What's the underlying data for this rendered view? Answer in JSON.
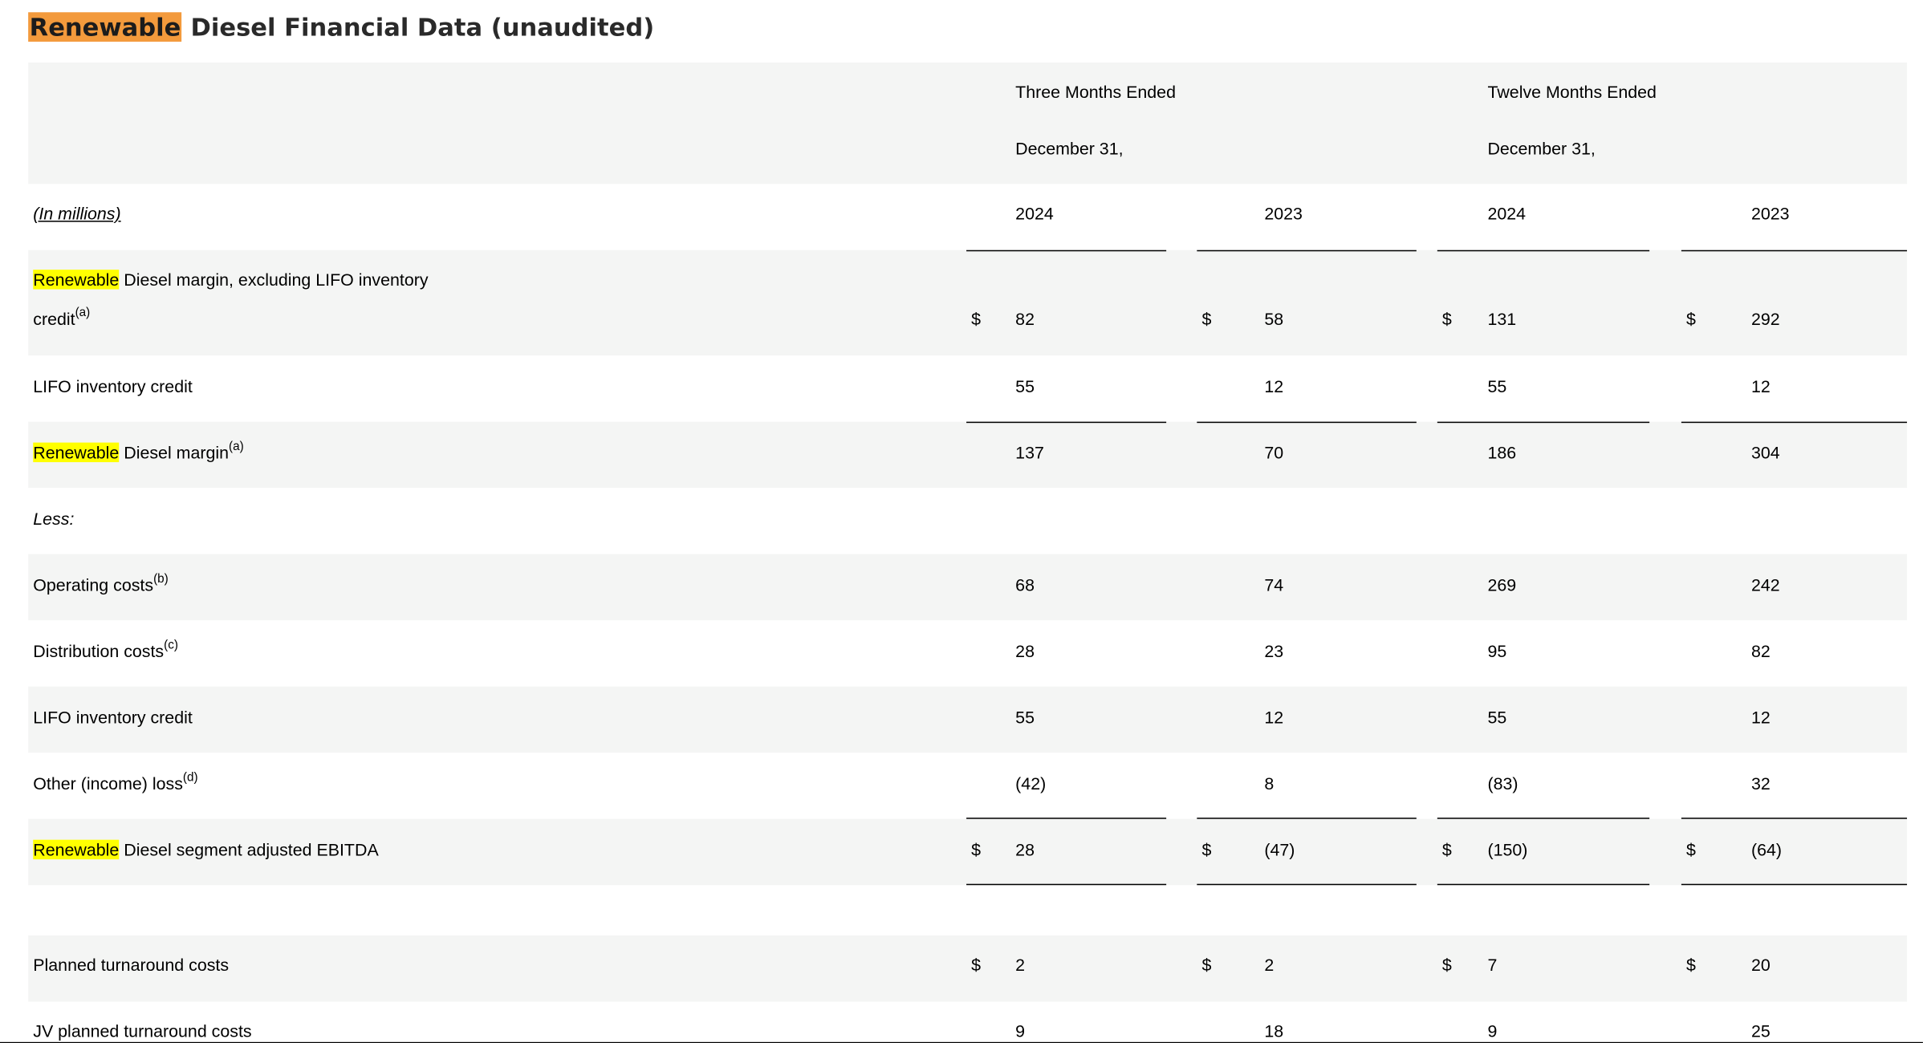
{
  "title": {
    "highlight": "Renewable",
    "rest": " Diesel Financial Data (unaudited)"
  },
  "header": {
    "three_months_line1": "Three Months Ended",
    "three_months_line2": "December 31,",
    "twelve_months_line1": "Twelve Months Ended",
    "twelve_months_line2": "December 31,",
    "units_label": "(In millions)",
    "years": [
      "2024",
      "2023",
      "2024",
      "2023"
    ]
  },
  "rows": {
    "rd_margin_ex_lifo": {
      "highlight": "Renewable",
      "label_line1": " Diesel margin, excluding LIFO inventory",
      "label_line2": "credit",
      "note": "(a)",
      "currency": "$",
      "values": [
        "82",
        "58",
        "131",
        "292"
      ]
    },
    "lifo_credit": {
      "label": "LIFO inventory credit",
      "values": [
        "55",
        "12",
        "55",
        "12"
      ]
    },
    "rd_margin": {
      "highlight": "Renewable",
      "label": " Diesel margin",
      "note": "(a)",
      "values": [
        "137",
        "70",
        "186",
        "304"
      ]
    },
    "less": {
      "label": "Less:"
    },
    "operating_costs": {
      "label": "Operating costs",
      "note": "(b)",
      "values": [
        "68",
        "74",
        "269",
        "242"
      ]
    },
    "distribution_costs": {
      "label": "Distribution costs",
      "note": "(c)",
      "values": [
        "28",
        "23",
        "95",
        "82"
      ]
    },
    "lifo_credit_2": {
      "label": "LIFO inventory credit",
      "values": [
        "55",
        "12",
        "55",
        "12"
      ]
    },
    "other_income_loss": {
      "label": "Other (income) loss",
      "note": "(d)",
      "values": [
        "(42)",
        "8",
        "(83)",
        "32"
      ]
    },
    "adjusted_ebitda": {
      "highlight": "Renewable",
      "label": " Diesel segment adjusted EBITDA",
      "currency": "$",
      "values": [
        "28",
        "(47)",
        "(150)",
        "(64)"
      ]
    },
    "planned_turnaround": {
      "label": "Planned turnaround costs",
      "currency": "$",
      "values": [
        "2",
        "2",
        "7",
        "20"
      ]
    },
    "jv_planned_turnaround": {
      "label": "JV planned turnaround costs",
      "values": [
        "9",
        "18",
        "9",
        "25"
      ]
    }
  }
}
